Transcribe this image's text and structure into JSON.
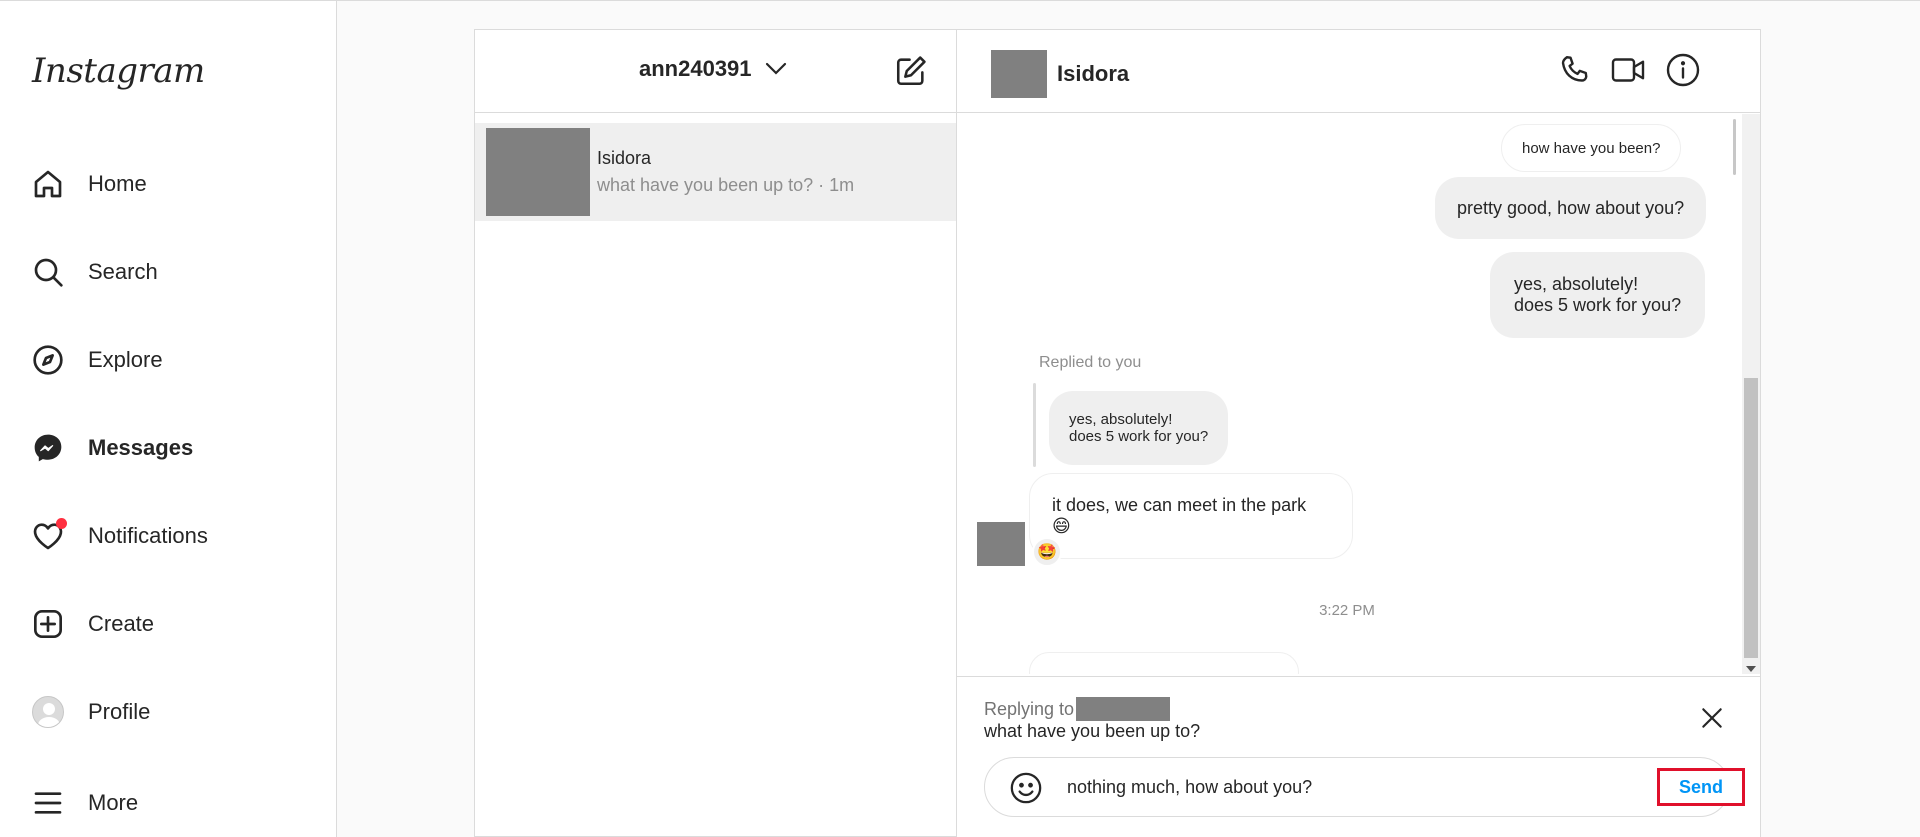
{
  "sidebar": {
    "logo": "Instagram",
    "items": [
      {
        "label": "Home",
        "icon": "home-icon"
      },
      {
        "label": "Search",
        "icon": "search-icon"
      },
      {
        "label": "Explore",
        "icon": "explore-compass-icon"
      },
      {
        "label": "Messages",
        "icon": "messenger-icon",
        "active": true
      },
      {
        "label": "Notifications",
        "icon": "heart-icon",
        "badge": true
      },
      {
        "label": "Create",
        "icon": "plus-square-icon"
      },
      {
        "label": "Profile",
        "icon": "avatar"
      },
      {
        "label": "More",
        "icon": "menu-icon"
      }
    ]
  },
  "inbox": {
    "account": "ann240391",
    "threads": [
      {
        "name": "Isidora",
        "preview": "what have you been up to? · 1m"
      }
    ]
  },
  "chat": {
    "name": "Isidora",
    "messages": [
      {
        "text": "how have you been?"
      },
      {
        "text": "pretty good, how about you?"
      },
      {
        "line1": "yes, absolutely!",
        "line2": "does 5 work for you?"
      },
      {
        "replied_label": "Replied to you",
        "quote_line1": "yes, absolutely!",
        "quote_line2": "does 5 work for you?"
      },
      {
        "text": "it does, we can meet in the park",
        "emoji": "😄",
        "reaction": "🤩"
      }
    ],
    "timestamp": "3:22 PM"
  },
  "composer": {
    "replying_label": "Replying to",
    "replying_message": "what have you been up to?",
    "input_value": "nothing much, how about you?",
    "send_label": "Send"
  },
  "colors": {
    "accent": "#0095f6",
    "highlight": "#e0102b",
    "notification": "#ff3040"
  }
}
